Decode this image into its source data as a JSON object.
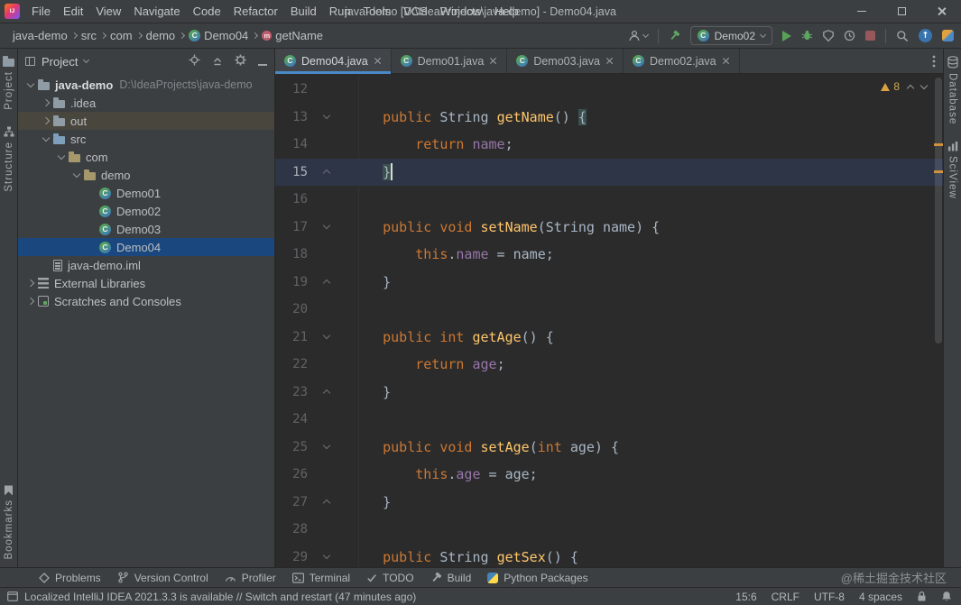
{
  "window": {
    "app_icon_text": "IJ",
    "menus": [
      "File",
      "Edit",
      "View",
      "Navigate",
      "Code",
      "Refactor",
      "Build",
      "Run",
      "Tools",
      "VCS",
      "Window",
      "Help"
    ],
    "title": "java-demo [D:\\IdeaProjects\\java-demo] - Demo04.java"
  },
  "nav": {
    "breadcrumbs": [
      {
        "label": "java-demo",
        "icon": null
      },
      {
        "label": "src",
        "icon": null
      },
      {
        "label": "com",
        "icon": null
      },
      {
        "label": "demo",
        "icon": null
      },
      {
        "label": "Demo04",
        "icon": "class"
      },
      {
        "label": "getName",
        "icon": "method"
      }
    ],
    "run_config": "Demo02",
    "tools": [
      "user",
      "sep",
      "hammer-green",
      "run-config",
      "play",
      "bug",
      "coverage",
      "profiler",
      "stop",
      "sep",
      "search",
      "up-circle",
      "sync"
    ]
  },
  "stripes": {
    "left_top": [
      {
        "label": "Project",
        "icon": "folder"
      },
      {
        "label": "Structure",
        "icon": "structure"
      }
    ],
    "left_bottom": [
      {
        "label": "Bookmarks",
        "icon": "bookmark"
      }
    ],
    "right": [
      {
        "label": "Database",
        "icon": "database"
      },
      {
        "label": "SciView",
        "icon": "sciview"
      }
    ]
  },
  "project_panel": {
    "title": "Project",
    "tools": [
      "locate",
      "collapse",
      "gear",
      "minus"
    ],
    "tree": [
      {
        "label": "java-demo",
        "path": "D:\\IdeaProjects\\java-demo",
        "icon": "folder",
        "level": 0,
        "chevron": "down",
        "bold": true
      },
      {
        "label": ".idea",
        "icon": "folder",
        "level": 1,
        "chevron": "right"
      },
      {
        "label": "out",
        "icon": "folder",
        "level": 1,
        "chevron": "right",
        "hover": true
      },
      {
        "label": "src",
        "icon": "folder-src",
        "level": 1,
        "chevron": "down"
      },
      {
        "label": "com",
        "icon": "package",
        "level": 2,
        "chevron": "down"
      },
      {
        "label": "demo",
        "icon": "package",
        "level": 3,
        "chevron": "down"
      },
      {
        "label": "Demo01",
        "icon": "class",
        "level": 4,
        "chevron": "none"
      },
      {
        "label": "Demo02",
        "icon": "class",
        "level": 4,
        "chevron": "none"
      },
      {
        "label": "Demo03",
        "icon": "class",
        "level": 4,
        "chevron": "none"
      },
      {
        "label": "Demo04",
        "icon": "class",
        "level": 4,
        "chevron": "none",
        "selected": true
      },
      {
        "label": "java-demo.iml",
        "icon": "file",
        "level": 1,
        "chevron": "none"
      },
      {
        "label": "External Libraries",
        "icon": "library",
        "level": 0,
        "chevron": "right"
      },
      {
        "label": "Scratches and Consoles",
        "icon": "scratch",
        "level": 0,
        "chevron": "right"
      }
    ]
  },
  "editor": {
    "tabs": [
      {
        "label": "Demo04.java",
        "active": true
      },
      {
        "label": "Demo01.java",
        "active": false
      },
      {
        "label": "Demo03.java",
        "active": false
      },
      {
        "label": "Demo02.java",
        "active": false
      }
    ],
    "warnings": "8",
    "lines": [
      {
        "n": "12",
        "tokens": []
      },
      {
        "n": "13",
        "fold": "down",
        "tokens": [
          [
            "p",
            "    "
          ],
          [
            "k",
            "public"
          ],
          [
            "p",
            " String "
          ],
          [
            "m",
            "getName"
          ],
          [
            "p",
            "() "
          ],
          [
            "bm",
            "{"
          ]
        ]
      },
      {
        "n": "14",
        "tokens": [
          [
            "p",
            "        "
          ],
          [
            "k",
            "return"
          ],
          [
            "p",
            " "
          ],
          [
            "f",
            "name"
          ],
          [
            "p",
            ";"
          ]
        ]
      },
      {
        "n": "15",
        "fold": "up",
        "current": true,
        "caret": true,
        "tokens": [
          [
            "p",
            "    "
          ],
          [
            "bm",
            "}"
          ]
        ]
      },
      {
        "n": "16",
        "tokens": []
      },
      {
        "n": "17",
        "fold": "down",
        "tokens": [
          [
            "p",
            "    "
          ],
          [
            "k",
            "public"
          ],
          [
            "p",
            " "
          ],
          [
            "k",
            "void"
          ],
          [
            "p",
            " "
          ],
          [
            "m",
            "setName"
          ],
          [
            "p",
            "(String name) {"
          ]
        ]
      },
      {
        "n": "18",
        "tokens": [
          [
            "p",
            "        "
          ],
          [
            "k",
            "this"
          ],
          [
            "p",
            "."
          ],
          [
            "f",
            "name"
          ],
          [
            "p",
            " = name;"
          ]
        ]
      },
      {
        "n": "19",
        "fold": "up",
        "tokens": [
          [
            "p",
            "    }"
          ]
        ]
      },
      {
        "n": "20",
        "tokens": []
      },
      {
        "n": "21",
        "fold": "down",
        "tokens": [
          [
            "p",
            "    "
          ],
          [
            "k",
            "public"
          ],
          [
            "p",
            " "
          ],
          [
            "k",
            "int"
          ],
          [
            "p",
            " "
          ],
          [
            "m",
            "getAge"
          ],
          [
            "p",
            "() {"
          ]
        ]
      },
      {
        "n": "22",
        "tokens": [
          [
            "p",
            "        "
          ],
          [
            "k",
            "return"
          ],
          [
            "p",
            " "
          ],
          [
            "f",
            "age"
          ],
          [
            "p",
            ";"
          ]
        ]
      },
      {
        "n": "23",
        "fold": "up",
        "tokens": [
          [
            "p",
            "    }"
          ]
        ]
      },
      {
        "n": "24",
        "tokens": []
      },
      {
        "n": "25",
        "fold": "down",
        "tokens": [
          [
            "p",
            "    "
          ],
          [
            "k",
            "public"
          ],
          [
            "p",
            " "
          ],
          [
            "k",
            "void"
          ],
          [
            "p",
            " "
          ],
          [
            "m",
            "setAge"
          ],
          [
            "p",
            "("
          ],
          [
            "k",
            "int"
          ],
          [
            "p",
            " age) {"
          ]
        ]
      },
      {
        "n": "26",
        "tokens": [
          [
            "p",
            "        "
          ],
          [
            "k",
            "this"
          ],
          [
            "p",
            "."
          ],
          [
            "f",
            "age"
          ],
          [
            "p",
            " = age;"
          ]
        ]
      },
      {
        "n": "27",
        "fold": "up",
        "tokens": [
          [
            "p",
            "    }"
          ]
        ]
      },
      {
        "n": "28",
        "tokens": []
      },
      {
        "n": "29",
        "fold": "down",
        "tokens": [
          [
            "p",
            "    "
          ],
          [
            "k",
            "public"
          ],
          [
            "p",
            " String "
          ],
          [
            "m",
            "getSex"
          ],
          [
            "p",
            "() {"
          ]
        ]
      }
    ]
  },
  "bottom_toolbar": {
    "items": [
      {
        "label": "Problems",
        "icon": "problems"
      },
      {
        "label": "Version Control",
        "icon": "vcs"
      },
      {
        "label": "Profiler",
        "icon": "gauge"
      },
      {
        "label": "Terminal",
        "icon": "terminal"
      },
      {
        "label": "TODO",
        "icon": "todo"
      },
      {
        "label": "Build",
        "icon": "hammer-gray"
      },
      {
        "label": "Python Packages",
        "icon": "python"
      }
    ],
    "watermark": "@稀土掘金技术社区"
  },
  "status_bar": {
    "message": "Localized IntelliJ IDEA 2021.3.3 is available // Switch and restart (47 minutes ago)",
    "caret_position": "15:6",
    "line_separator": "CRLF",
    "encoding": "UTF-8",
    "indent": "4 spaces"
  }
}
